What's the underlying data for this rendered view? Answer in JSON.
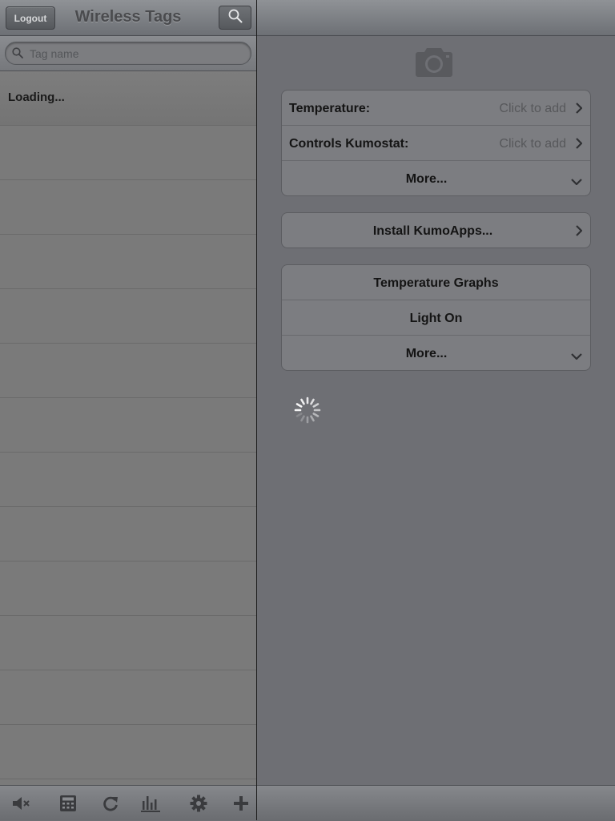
{
  "navbar": {
    "logout_label": "Logout",
    "title": "Wireless Tags"
  },
  "search": {
    "placeholder": "Tag name"
  },
  "list": {
    "loading_text": "Loading..."
  },
  "toolbar": {
    "icons": [
      "mute-icon",
      "calculator-icon",
      "refresh-icon",
      "bar-chart-icon",
      "gear-icon",
      "add-icon"
    ]
  },
  "detail": {
    "camera_icon": "camera-icon",
    "info_group": [
      {
        "label": "Temperature:",
        "value": "Click to add"
      },
      {
        "label": "Controls Kumostat:",
        "value": "Click to add"
      },
      {
        "label": "More..."
      }
    ],
    "install_label": "Install KumoApps...",
    "actions_group": [
      {
        "label": "Temperature Graphs"
      },
      {
        "label": "Light On"
      },
      {
        "label": "More..."
      }
    ]
  },
  "colors": {
    "background": "#6e6f74",
    "left_panel": "#7a7a7a",
    "text_dark": "#141414",
    "text_muted": "#57585b"
  }
}
